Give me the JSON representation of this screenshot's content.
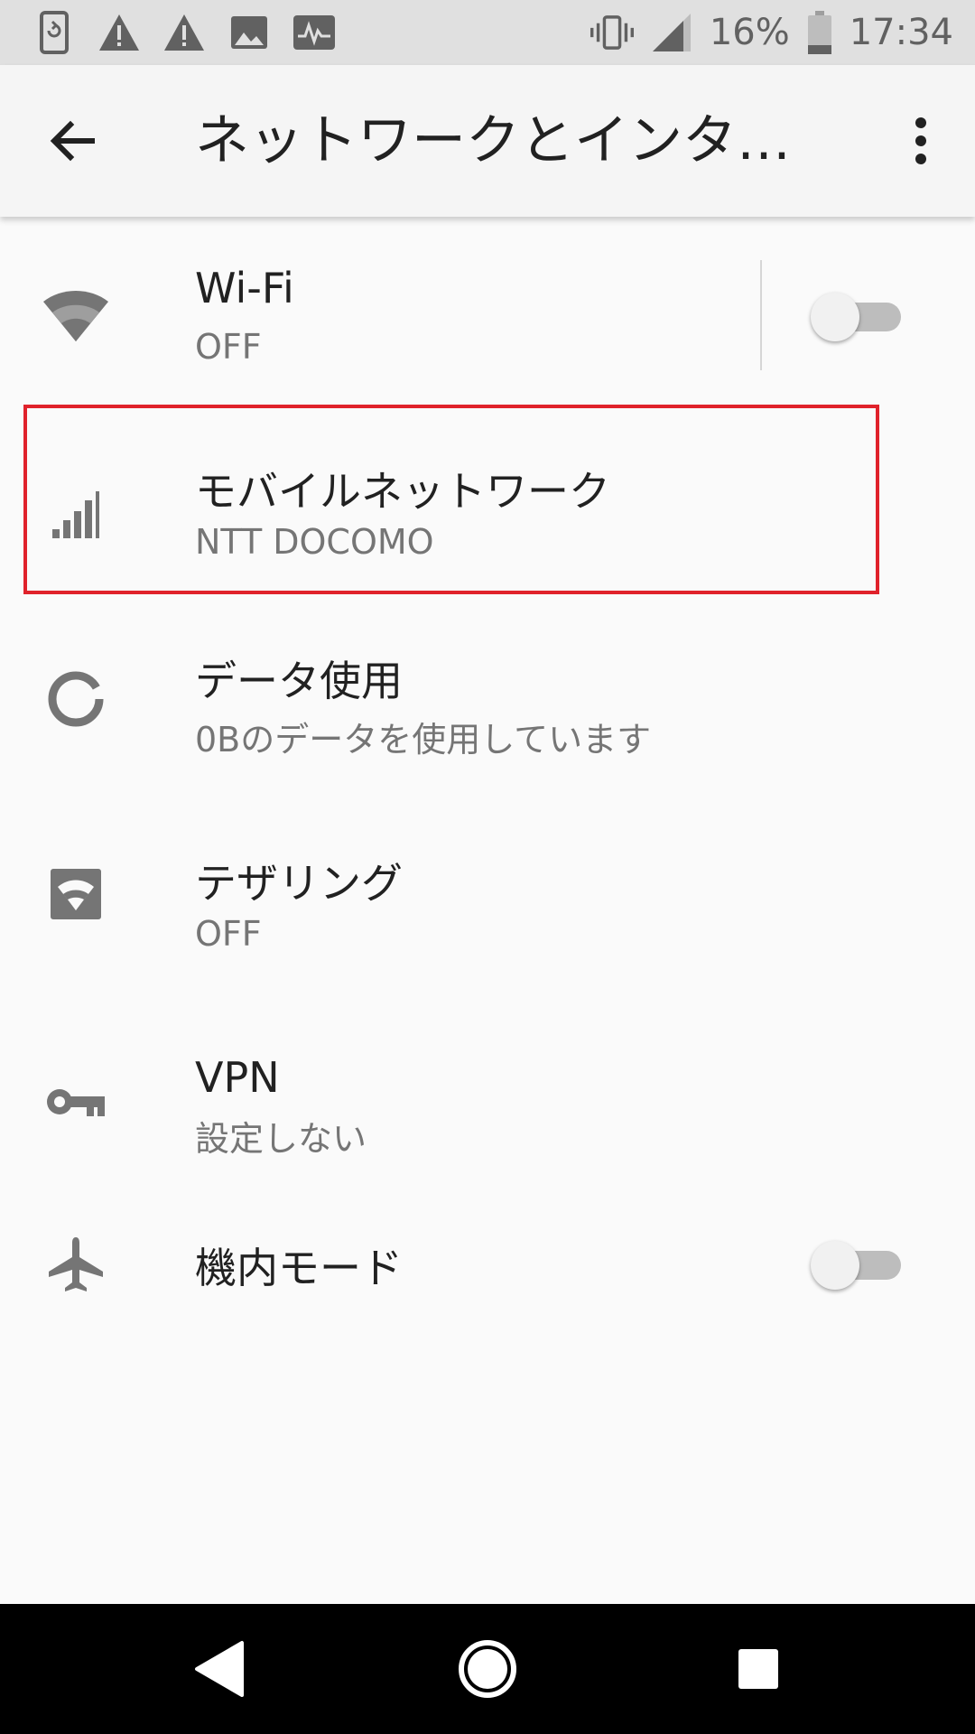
{
  "status_bar": {
    "battery_percent": "16%",
    "time": "17:34",
    "left_icons": [
      "screen-rotation-icon",
      "warning-icon",
      "warning-icon",
      "image-icon",
      "activity-icon"
    ],
    "right_icons": [
      "vibrate-icon",
      "cell-signal-icon",
      "battery-icon"
    ]
  },
  "toolbar": {
    "title": "ネットワークとインター..."
  },
  "items": [
    {
      "title": "Wi-Fi",
      "summary": "OFF",
      "icon": "wifi-icon",
      "switch_on": false
    },
    {
      "title": "モバイルネットワーク",
      "summary": "NTT DOCOMO",
      "icon": "cell-signal-icon"
    },
    {
      "title": "データ使用",
      "summary": "0Bのデータを使用しています",
      "icon": "data-usage-icon"
    },
    {
      "title": "テザリング",
      "summary": "OFF",
      "icon": "hotspot-icon"
    },
    {
      "title": "VPN",
      "summary": "設定しない",
      "icon": "key-icon"
    },
    {
      "title": "機内モード",
      "icon": "airplane-icon",
      "switch_on": false
    }
  ],
  "colors": {
    "highlight_border": "#e0222b",
    "icon_gray": "#757575"
  }
}
